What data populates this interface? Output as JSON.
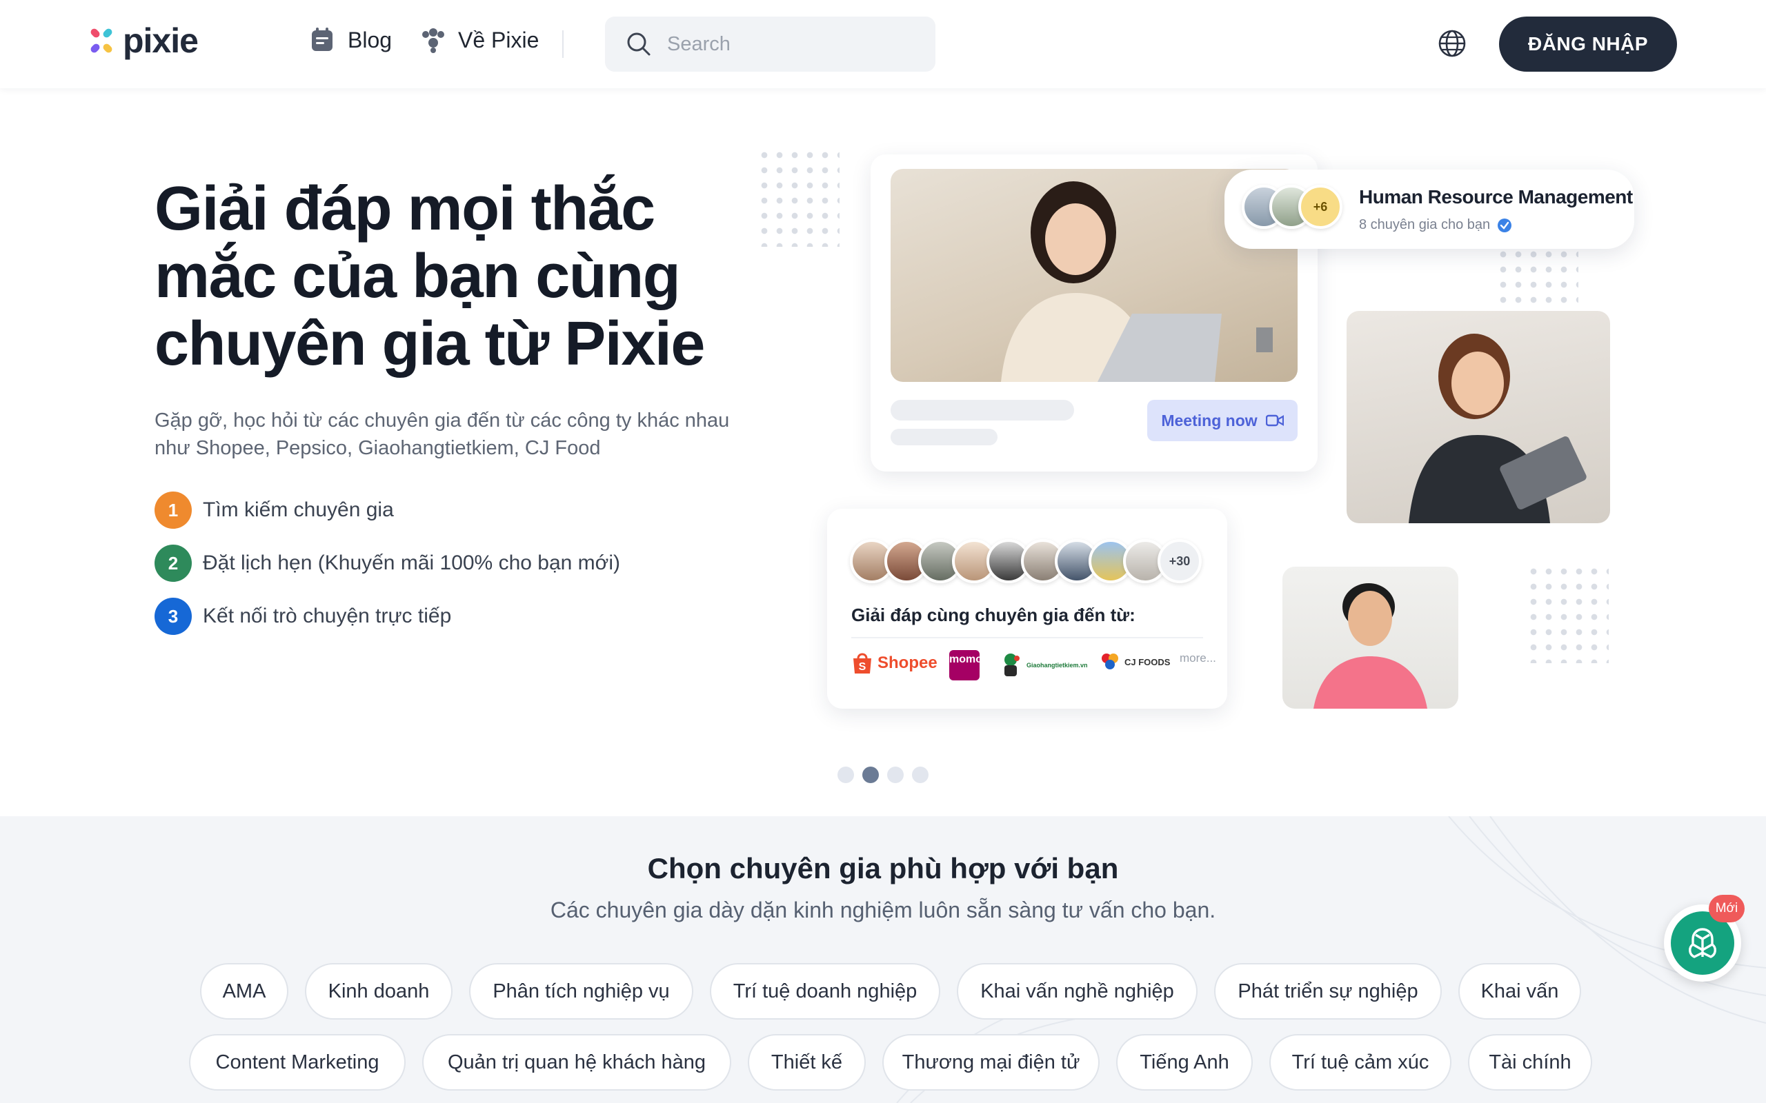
{
  "header": {
    "logo_text": "pixie",
    "nav": [
      {
        "label": "Blog",
        "icon": "blog-note-icon"
      },
      {
        "label": "Về Pixie",
        "icon": "people-group-icon"
      }
    ],
    "search_placeholder": "Search",
    "login_label": "ĐĂNG NHẬP"
  },
  "hero": {
    "title": "Giải đáp mọi thắc mắc của bạn cùng chuyên gia từ Pixie",
    "subtitle": "Gặp gỡ, học hỏi từ các chuyên gia đến từ các công ty khác nhau như Shopee, Pepsico, Giaohangtietkiem, CJ Food",
    "steps": [
      {
        "num": "1",
        "text": "Tìm kiếm chuyên gia",
        "color": "#ef8a2e"
      },
      {
        "num": "2",
        "text": "Đặt lịch hẹn (Khuyến mãi 100% cho bạn mới)",
        "color": "#2e8a5b"
      },
      {
        "num": "3",
        "text": "Kết nối trò chuyện trực tiếp",
        "color": "#1668d6"
      }
    ]
  },
  "illustration": {
    "meeting_button": "Meeting now",
    "hr_card": {
      "title": "Human Resource Management",
      "subtitle": "8 chuyên gia cho bạn",
      "more": "+6"
    },
    "experts_card": {
      "more": "+30",
      "heading": "Giải đáp cùng chuyên gia đến từ:",
      "brands": [
        "Shopee",
        "momo",
        "Giaohangtietkiem.vn",
        "CJ FOODS"
      ],
      "more_label": "more..."
    }
  },
  "carousel": {
    "count": 4,
    "active_index": 1
  },
  "section": {
    "title": "Chọn chuyên gia phù hợp với bạn",
    "subtitle": "Các chuyên gia dày dặn kinh nghiệm luôn sẵn sàng tư vấn cho bạn.",
    "categories_row1": [
      "AMA",
      "Kinh doanh",
      "Phân tích nghiệp vụ",
      "Trí tuệ doanh nghiệp",
      "Khai vấn nghề nghiệp",
      "Phát triển sự nghiệp",
      "Khai vấn"
    ],
    "categories_row2": [
      "Content Marketing",
      "Quản trị quan hệ khách hàng",
      "Thiết kế",
      "Thương mại điện tử",
      "Tiếng Anh",
      "Trí tuệ cảm xúc",
      "Tài chính"
    ]
  },
  "chat_widget": {
    "badge": "Mới",
    "icon": "openai-chat-icon"
  }
}
